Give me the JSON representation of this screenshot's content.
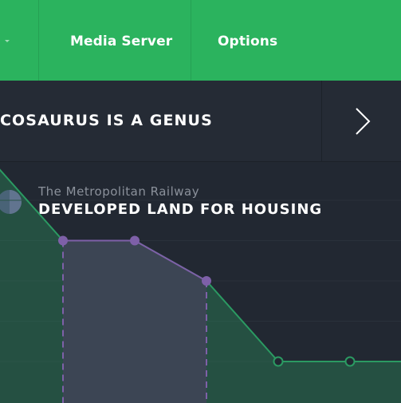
{
  "nav": {
    "items": [
      {
        "label": "Media Server"
      },
      {
        "label": "Options"
      }
    ]
  },
  "headline": {
    "text": "COSAURUS IS A GENUS"
  },
  "chart_data": {
    "type": "area",
    "subtitle": "The Metropolitan Railway",
    "title": "DEVELOPED LAND FOR HOUSING",
    "series": [
      {
        "color": "#2b9a62",
        "values": [
          5,
          3,
          3,
          2,
          0,
          0,
          0
        ]
      },
      {
        "color": "#7e60a8",
        "values": [
          null,
          3,
          3,
          2,
          null,
          null,
          null
        ]
      }
    ],
    "x": [
      0,
      1,
      2,
      3,
      4,
      5,
      6
    ],
    "ylim": [
      0,
      6
    ],
    "grid": true
  },
  "colors": {
    "nav_bg": "#2bb35e",
    "headline_bg": "#252b35",
    "content_bg": "#222832",
    "green_series": "#2b9a62",
    "purple_series": "#7e60a8"
  }
}
